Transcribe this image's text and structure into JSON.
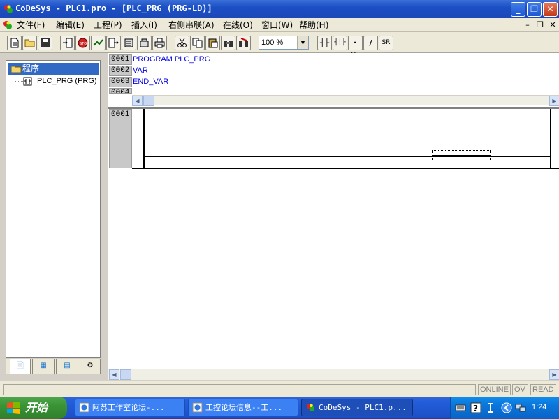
{
  "window": {
    "title": "CoDeSys - PLC1.pro - [PLC_PRG (PRG-LD)]",
    "minimize": "_",
    "maximize": "❐",
    "close": "✕"
  },
  "menu": {
    "items": [
      {
        "label": "文件(F)",
        "name": "menu-file"
      },
      {
        "label": "编辑(E)",
        "name": "menu-edit"
      },
      {
        "label": "工程(P)",
        "name": "menu-project"
      },
      {
        "label": "插入(I)",
        "name": "menu-insert"
      },
      {
        "label": "右侧串联(A)",
        "name": "menu-right-series"
      },
      {
        "label": "在线(O)",
        "name": "menu-online"
      },
      {
        "label": "窗口(W)",
        "name": "menu-window"
      },
      {
        "label": "帮助(H)",
        "name": "menu-help"
      }
    ],
    "mdi_minimize": "–",
    "mdi_restore": "❐",
    "mdi_close": "✕"
  },
  "toolbar": {
    "zoom_value": "100 %",
    "ld_contact": "┤├",
    "ld_parallel_contact": "┤|├",
    "ld_coil": "-()-",
    "ld_line": "/",
    "ld_sr": "SR"
  },
  "tree": {
    "root_label": "程序",
    "node_label": "PLC_PRG (PRG)"
  },
  "left_tabs": [
    {
      "name": "tab-pous",
      "label": "📄"
    },
    {
      "name": "tab-datatypes",
      "label": "▦"
    },
    {
      "name": "tab-visualizations",
      "label": "▤"
    },
    {
      "name": "tab-resources",
      "label": "⚙"
    }
  ],
  "declaration": {
    "lines": [
      {
        "num": "0001",
        "text": "PROGRAM PLC_PRG"
      },
      {
        "num": "0002",
        "text": "VAR"
      },
      {
        "num": "0003",
        "text": "END_VAR"
      },
      {
        "num": "0004",
        "text": ""
      }
    ]
  },
  "ladder": {
    "network_number": "0001"
  },
  "status": {
    "online": "ONLINE",
    "ov": "OV",
    "read": "READ"
  },
  "taskbar": {
    "start_label": "开始",
    "tasks": [
      {
        "label": "阿苏工作室论坛-...",
        "active": false
      },
      {
        "label": "工控论坛信息--工...",
        "active": false
      },
      {
        "label": "CoDeSys - PLC1.p...",
        "active": true
      }
    ],
    "clock": "1:24"
  },
  "colors": {
    "titlebar": "#1b4fc4",
    "selection": "#316ac5",
    "code_text": "#0000c8",
    "taskbar": "#245edb",
    "start_button": "#3a9436"
  }
}
